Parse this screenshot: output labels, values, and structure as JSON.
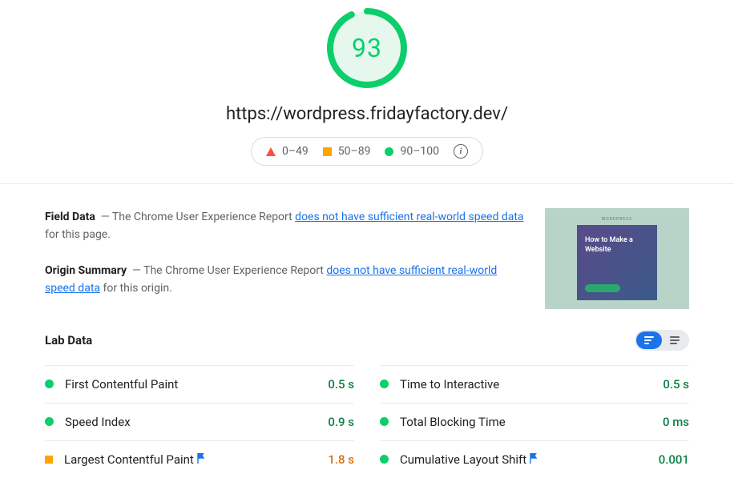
{
  "score": {
    "value": "93",
    "percent": 93,
    "color": "#0cce6b",
    "bg": "#e6f8ee"
  },
  "url": "https://wordpress.fridayfactory.dev/",
  "legend": {
    "poor": "0–49",
    "avg": "50–89",
    "good": "90–100"
  },
  "field_data": {
    "label": "Field Data",
    "pre": "— The Chrome User Experience Report ",
    "link": "does not have sufficient real-world speed data",
    "post": " for this page."
  },
  "origin_summary": {
    "label": "Origin Summary",
    "pre": "— The Chrome User Experience Report ",
    "link": "does not have sufficient real-world speed data",
    "post": " for this origin."
  },
  "thumbnail": {
    "brand": "WORDPRESS",
    "headline": "How to Make a Website"
  },
  "lab_label": "Lab Data",
  "metrics_left": [
    {
      "name": "First Contentful Paint",
      "value": "0.5 s",
      "status": "good",
      "flag": false
    },
    {
      "name": "Speed Index",
      "value": "0.9 s",
      "status": "good",
      "flag": false
    },
    {
      "name": "Largest Contentful Paint",
      "value": "1.8 s",
      "status": "avg",
      "flag": true
    }
  ],
  "metrics_right": [
    {
      "name": "Time to Interactive",
      "value": "0.5 s",
      "status": "good",
      "flag": false
    },
    {
      "name": "Total Blocking Time",
      "value": "0 ms",
      "status": "good",
      "flag": false
    },
    {
      "name": "Cumulative Layout Shift",
      "value": "0.001",
      "status": "good",
      "flag": true
    }
  ]
}
